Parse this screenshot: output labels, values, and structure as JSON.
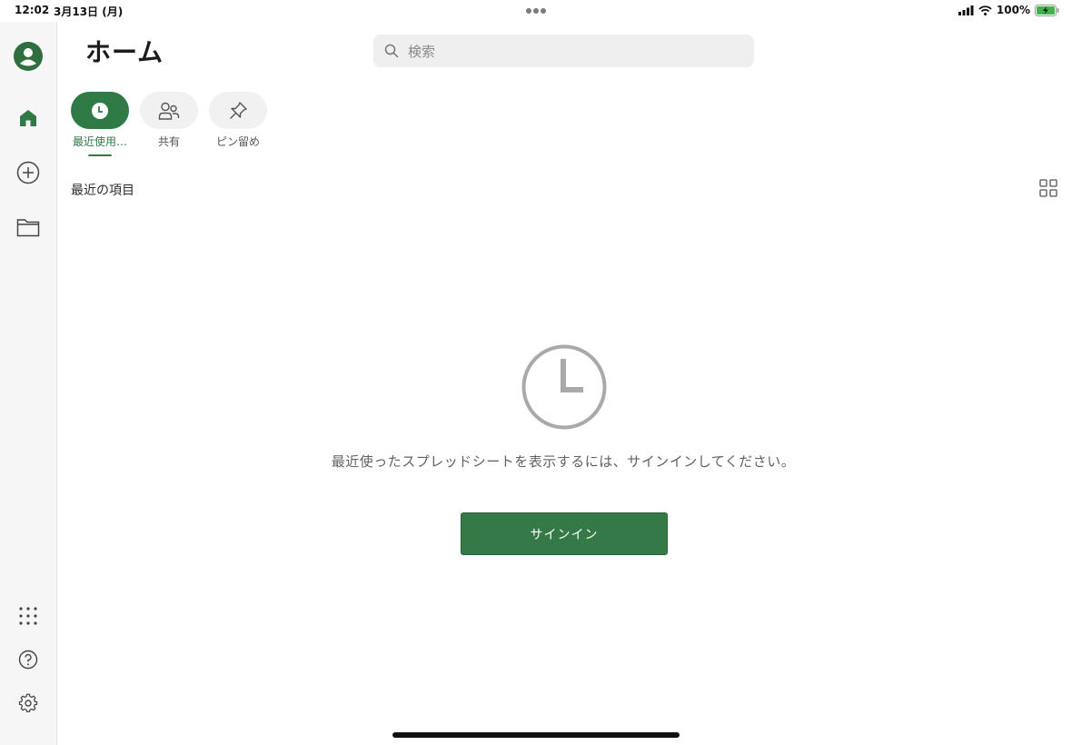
{
  "status_bar": {
    "time": "12:02",
    "date": "3月13日 (月)",
    "battery": "100%"
  },
  "sidebar": {
    "items": [
      {
        "name": "account",
        "icon": "user-circle-icon"
      },
      {
        "name": "home",
        "icon": "home-icon"
      },
      {
        "name": "new",
        "icon": "plus-circle-icon"
      },
      {
        "name": "open",
        "icon": "folder-icon"
      },
      {
        "name": "apps",
        "icon": "app-grid-icon"
      },
      {
        "name": "help",
        "icon": "help-icon"
      },
      {
        "name": "settings",
        "icon": "gear-icon"
      }
    ]
  },
  "header": {
    "title": "ホーム",
    "search_placeholder": "検索"
  },
  "tabs": [
    {
      "label": "最近使用…",
      "icon": "clock-icon",
      "active": true
    },
    {
      "label": "共有",
      "icon": "people-icon",
      "active": false
    },
    {
      "label": "ピン留め",
      "icon": "pin-icon",
      "active": false
    }
  ],
  "section": {
    "title": "最近の項目"
  },
  "empty_state": {
    "message": "最近使ったスプレッドシートを表示するには、サインインしてください。",
    "button_label": "サインイン"
  },
  "colors": {
    "accent": "#2f7a45",
    "sidebar_bg": "#f6f6f6"
  }
}
